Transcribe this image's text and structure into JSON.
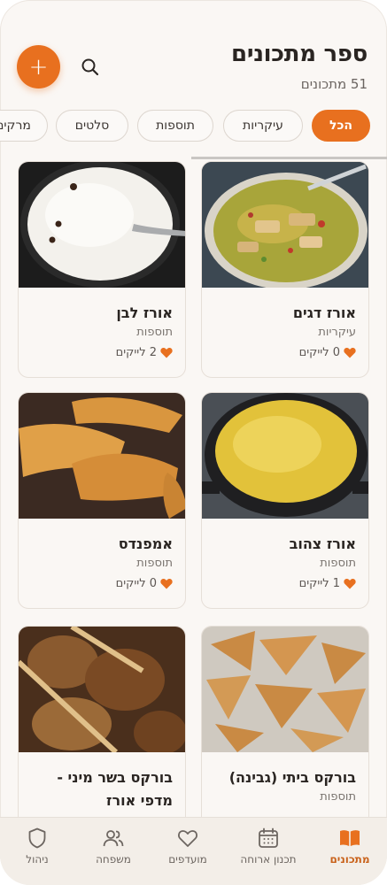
{
  "header": {
    "title": "ספר מתכונים",
    "subtitle": "51 מתכונים",
    "add_label": "+"
  },
  "filters": [
    {
      "label": "הכל",
      "active": true
    },
    {
      "label": "עיקריות",
      "active": false
    },
    {
      "label": "תוספות",
      "active": false
    },
    {
      "label": "סלטים",
      "active": false
    },
    {
      "label": "מרקים",
      "active": false
    }
  ],
  "recipes": [
    {
      "title": "אורז דגים",
      "category": "עיקריות",
      "likes": "0 לייקים"
    },
    {
      "title": "אורז לבן",
      "category": "תוספות",
      "likes": "2 לייקים"
    },
    {
      "title": "אורז צהוב",
      "category": "תוספות",
      "likes": "1 לייקים"
    },
    {
      "title": "אמפנדס",
      "category": "תוספות",
      "likes": "0 לייקים"
    },
    {
      "title": "בורקס ביתי (גבינה)",
      "category": "תוספות",
      "likes": ""
    },
    {
      "title": "בורקס בשר מיני - מדפי אורז",
      "category": "",
      "likes": ""
    }
  ],
  "bottom_nav": [
    {
      "label": "מתכונים",
      "icon": "book-icon",
      "active": true
    },
    {
      "label": "תכנון ארוחה",
      "icon": "calendar-icon",
      "active": false
    },
    {
      "label": "מועדפים",
      "icon": "heart-icon",
      "active": false
    },
    {
      "label": "משפחה",
      "icon": "people-icon",
      "active": false
    },
    {
      "label": "ניהול",
      "icon": "shield-icon",
      "active": false
    }
  ],
  "colors": {
    "accent": "#e8701f",
    "background": "#faf7f4",
    "nav_background": "#f3eee8"
  }
}
